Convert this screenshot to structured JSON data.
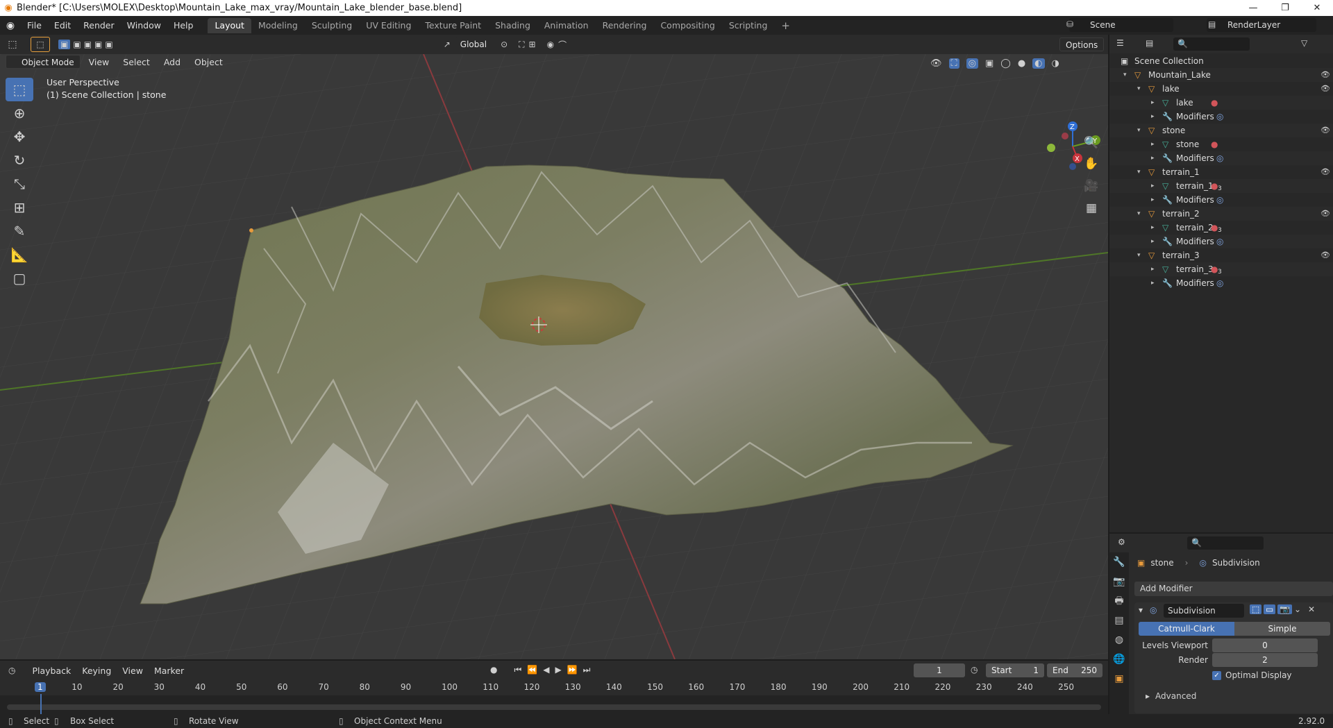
{
  "window": {
    "title": "Blender* [C:\\Users\\MOLEX\\Desktop\\Mountain_Lake_max_vray/Mountain_Lake_blender_base.blend]",
    "minimize": "—",
    "restore": "❐",
    "close": "✕"
  },
  "menubar": {
    "items": [
      "File",
      "Edit",
      "Render",
      "Window",
      "Help"
    ]
  },
  "workspaces": {
    "tabs": [
      "Layout",
      "Modeling",
      "Sculpting",
      "UV Editing",
      "Texture Paint",
      "Shading",
      "Animation",
      "Rendering",
      "Compositing",
      "Scripting"
    ],
    "active": "Layout",
    "add": "+"
  },
  "scene": {
    "name": "Scene",
    "view_layer": "RenderLayer"
  },
  "viewport_header": {
    "mode": "Object Mode",
    "menus": [
      "View",
      "Select",
      "Add",
      "Object"
    ],
    "transform_orientation": "Global",
    "options": "Options"
  },
  "viewport": {
    "perspective_label": "User Perspective",
    "collection_label": "(1) Scene Collection | stone",
    "gizmo": {
      "x": "X",
      "y": "Y",
      "z": "Z"
    }
  },
  "outliner": {
    "rows": [
      {
        "label": "Scene Collection",
        "icon": "scene-collection-icon",
        "indent": 0
      },
      {
        "label": "Mountain_Lake",
        "icon": "object-icon",
        "indent": 1,
        "eye": true
      },
      {
        "label": "lake",
        "icon": "object-icon",
        "indent": 2,
        "eye": true
      },
      {
        "label": "lake",
        "icon": "mesh-icon",
        "indent": 3
      },
      {
        "label": "Modifiers",
        "icon": "wrench-icon",
        "indent": 3
      },
      {
        "label": "stone",
        "icon": "object-icon",
        "indent": 2,
        "eye": true
      },
      {
        "label": "stone",
        "icon": "mesh-icon",
        "indent": 3
      },
      {
        "label": "Modifiers",
        "icon": "wrench-icon",
        "indent": 3
      },
      {
        "label": "terrain_1",
        "icon": "object-icon",
        "indent": 2,
        "eye": true
      },
      {
        "label": "terrain_1",
        "icon": "mesh-icon",
        "indent": 3,
        "badge": "3"
      },
      {
        "label": "Modifiers",
        "icon": "wrench-icon",
        "indent": 3
      },
      {
        "label": "terrain_2",
        "icon": "object-icon",
        "indent": 2,
        "eye": true
      },
      {
        "label": "terrain_2",
        "icon": "mesh-icon",
        "indent": 3,
        "badge": "3"
      },
      {
        "label": "Modifiers",
        "icon": "wrench-icon",
        "indent": 3
      },
      {
        "label": "terrain_3",
        "icon": "object-icon",
        "indent": 2,
        "eye": true
      },
      {
        "label": "terrain_3",
        "icon": "mesh-icon",
        "indent": 3,
        "badge": "3"
      },
      {
        "label": "Modifiers",
        "icon": "wrench-icon",
        "indent": 3
      }
    ]
  },
  "properties": {
    "breadcrumb_object": "stone",
    "breadcrumb_modifier": "Subdivision",
    "add_modifier": "Add Modifier",
    "modifier": {
      "name": "Subdivision",
      "method_catmull": "Catmull-Clark",
      "method_simple": "Simple",
      "levels_viewport_label": "Levels Viewport",
      "levels_viewport": "0",
      "render_label": "Render",
      "render": "2",
      "optimal_display": "Optimal Display",
      "advanced": "Advanced"
    }
  },
  "timeline": {
    "menus": [
      "Playback",
      "Keying",
      "View",
      "Marker"
    ],
    "current_frame": "1",
    "start_label": "Start",
    "start": "1",
    "end_label": "End",
    "end": "250",
    "ruler": [
      "1",
      "10",
      "20",
      "30",
      "40",
      "50",
      "60",
      "70",
      "80",
      "90",
      "100",
      "110",
      "120",
      "130",
      "140",
      "150",
      "160",
      "170",
      "180",
      "190",
      "200",
      "210",
      "220",
      "230",
      "240",
      "250"
    ]
  },
  "statusbar": {
    "select": "Select",
    "box_select": "Box Select",
    "rotate_view": "Rotate View",
    "context_menu": "Object Context Menu",
    "version": "2.92.0"
  },
  "colors": {
    "accent": "#4772b3",
    "x_axis": "#c8343c",
    "y_axis": "#6a9b1f",
    "z_axis": "#2f6fd6",
    "object_orange": "#e69a3c",
    "mesh_green": "#47b29b"
  }
}
